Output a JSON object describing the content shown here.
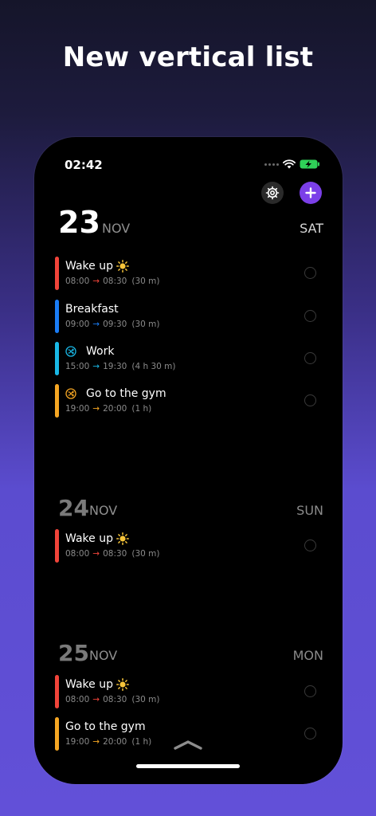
{
  "headline": "New vertical list",
  "status_bar": {
    "time": "02:42"
  },
  "colors": {
    "red": "#f0443a",
    "blue": "#1a7cf5",
    "cyan": "#19b8e6",
    "orange": "#f5a623",
    "accent": "#7b3fe8"
  },
  "days": [
    {
      "number": "23",
      "month": "NOV",
      "weekday": "SAT",
      "events": [
        {
          "title": "Wake up",
          "icon": "sun-icon",
          "start": "08:00",
          "end": "08:30",
          "duration": "(30 m)",
          "color": "red"
        },
        {
          "title": "Breakfast",
          "icon": "",
          "start": "09:00",
          "end": "09:30",
          "duration": "(30 m)",
          "color": "blue"
        },
        {
          "title": "Work",
          "icon": "shuffle-icon",
          "start": "15:00",
          "end": "19:30",
          "duration": "(4 h 30 m)",
          "color": "cyan"
        },
        {
          "title": "Go to the gym",
          "icon": "shuffle-icon",
          "start": "19:00",
          "end": "20:00",
          "duration": "(1 h)",
          "color": "orange"
        }
      ]
    },
    {
      "number": "24",
      "month": "NOV",
      "weekday": "SUN",
      "events": [
        {
          "title": "Wake up",
          "icon": "sun-icon",
          "start": "08:00",
          "end": "08:30",
          "duration": "(30 m)",
          "color": "red"
        }
      ]
    },
    {
      "number": "25",
      "month": "NOV",
      "weekday": "MON",
      "events": [
        {
          "title": "Wake up",
          "icon": "sun-icon",
          "start": "08:00",
          "end": "08:30",
          "duration": "(30 m)",
          "color": "red"
        },
        {
          "title": "Go to the gym",
          "icon": "",
          "start": "19:00",
          "end": "20:00",
          "duration": "(1 h)",
          "color": "orange"
        }
      ]
    }
  ]
}
